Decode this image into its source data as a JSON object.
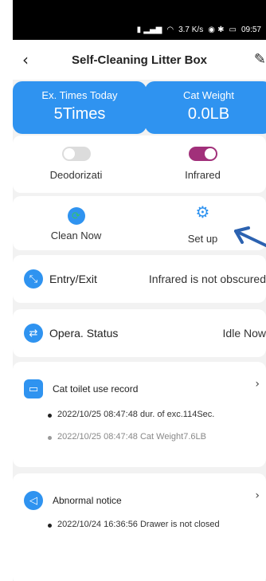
{
  "status_bar": {
    "time": "09:57",
    "speed": "3.7 K/s",
    "icons": [
      "signal-icon",
      "wifi-icon",
      "battery-icon"
    ]
  },
  "header": {
    "title": "Self-Cleaning Litter Box",
    "back_icon": "back-icon",
    "edit_icon": "edit-icon"
  },
  "stats": [
    {
      "label": "Ex. Times Today",
      "value": "5Times"
    },
    {
      "label": "Cat Weight",
      "value": "0.0LB"
    }
  ],
  "toggles": [
    {
      "label": "Deodorizati",
      "on": false
    },
    {
      "label": "Infrared",
      "on": true
    }
  ],
  "actions": [
    {
      "label": "Clean Now",
      "icon": "clean-icon"
    },
    {
      "label": "Set up",
      "icon": "gear-icon"
    }
  ],
  "entry_exit": {
    "label": "Entry/Exit",
    "value": "Infrared is not obscured"
  },
  "opera_status": {
    "label": "Opera. Status",
    "value": "Idle Now"
  },
  "use_record": {
    "label": "Cat toilet use record",
    "items": [
      "2022/10/25 08:47:48 dur. of exc.114Sec.",
      "2022/10/25 08:47:48 Cat Weight7.6LB"
    ]
  },
  "abnormal": {
    "label": "Abnormal notice",
    "items": [
      "2022/10/24 16:36:56 Drawer is not closed"
    ]
  },
  "colors": {
    "accent": "#2f93f0",
    "toggle_on": "#a1307a",
    "toggle_off": "#dcdcdc",
    "background": "#f2f2f2"
  }
}
